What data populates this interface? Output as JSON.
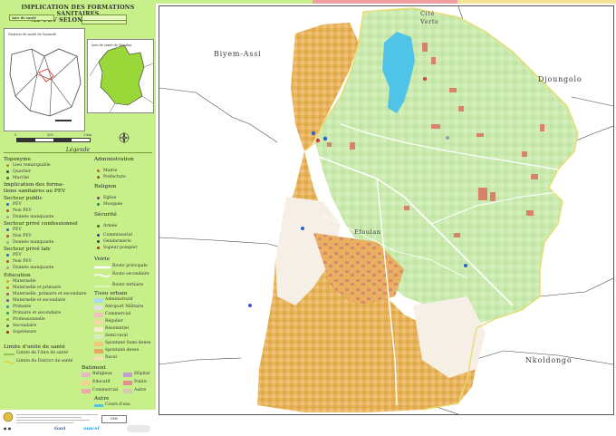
{
  "header": {
    "title_line1": "IMPLICATION DES FORMATIONS SANITAIRES",
    "title_line2": "AU PEV SELON LE STATUT:",
    "pill_left": "Aire de santé",
    "pill_right": ""
  },
  "insets": {
    "left_caption": "Districts de santé de Yaoundé",
    "right_caption": "Aire de santé de Ntoulou"
  },
  "scale": {
    "t0": "0",
    "t1": "500",
    "t2": "1 km"
  },
  "legend": {
    "title": "Légende",
    "toponymie": {
      "heading": "Toponyme",
      "items": [
        "Lieu remarquable",
        "Quartier",
        "Marché"
      ]
    },
    "implication": {
      "heading_line1": "Implication des forma-",
      "heading_line2": "tions sanitaires au PEV"
    },
    "public": {
      "heading": "Secteur public",
      "items": [
        "PEV",
        "Non PEV",
        "Donnée manquante"
      ]
    },
    "prive_conf": {
      "heading": "Secteur privé confessionnel",
      "items": [
        "PEV",
        "Non PEV",
        "Donnée manquante"
      ]
    },
    "prive_laic": {
      "heading": "Secteur privé laïc",
      "items": [
        "PEV",
        "Non PEV",
        "Donnée manquante"
      ]
    },
    "education": {
      "heading": "Education",
      "items": [
        "Maternelle",
        "Maternelle et primaire",
        "Maternelle, primaire et secondaire",
        "Maternelle et secondaire",
        "Primaire",
        "Primaire et secondaire",
        "Professionnelle",
        "Secondaire",
        "Supérieure"
      ]
    },
    "limites": {
      "heading": "Limite d'unité de santé",
      "items": [
        "Limite de l'Aire de santé",
        "Limite du District de santé"
      ]
    },
    "administration": {
      "heading": "Administration",
      "items": [
        "Mairie",
        "Préfecture"
      ]
    },
    "religion": {
      "heading": "Religion",
      "items": [
        "Eglise",
        "Mosquée"
      ]
    },
    "securite": {
      "heading": "Sécurité",
      "items": [
        "Armée",
        "Commissariat",
        "Gendarmerie",
        "Sapeur pompier"
      ]
    },
    "voirie": {
      "heading": "Voirie",
      "items": [
        "Route principale",
        "Route secondaire",
        "Route tertiaire"
      ]
    },
    "tissu": {
      "heading": "Tissu urbain",
      "items": [
        "Administratif",
        "Aéroport Militaire",
        "Commercial",
        "Régulier",
        "Résidentiel",
        "Semi-rural",
        "Spontané Semi dense",
        "Spontané dense",
        "Rural"
      ]
    },
    "batiment": {
      "heading": "Batiment",
      "items": [
        "Religieux",
        "Hôpital",
        "Educatif",
        "Public",
        "Commercial",
        "Autre"
      ]
    },
    "autre": {
      "heading": "Autre",
      "items": [
        "Cours d'eau"
      ]
    }
  },
  "footer": {
    "logo1": "Gavi",
    "logo2": "unicef",
    "box": "OMS"
  },
  "map_labels": {
    "cite_verte_1": "Cité",
    "cite_verte_2": "Verte",
    "biyem_assi": "Biyem-Assi",
    "djoungolo": "Djoungolo",
    "efoulan": "Efoulan",
    "nkoldongo": "Nkoldongo"
  },
  "colors": {
    "sidebar": "#c8f08a",
    "green_zone": "#c9eab0",
    "orange_zone": "#e9b660",
    "water": "#4fc3e8",
    "building": "#d9826a"
  }
}
